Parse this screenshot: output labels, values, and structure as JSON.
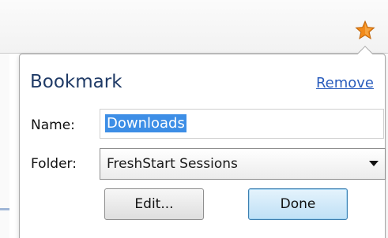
{
  "toolbar": {
    "star_icon": "star-icon",
    "star_color": "#f28a1a"
  },
  "bookmark": {
    "title": "Bookmark",
    "remove_label": "Remove",
    "name_label": "Name:",
    "name_value": "Downloads",
    "folder_label": "Folder:",
    "folder_value": "FreshStart Sessions",
    "edit_label": "Edit...",
    "done_label": "Done"
  },
  "colors": {
    "accent": "#2a5dbd",
    "selection": "#3d8ee6",
    "done_border": "#3c7fb1"
  }
}
